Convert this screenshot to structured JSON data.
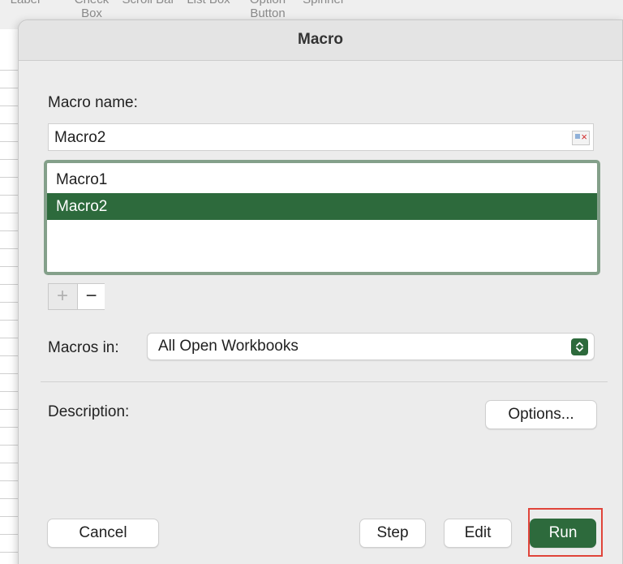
{
  "ribbon": {
    "items": [
      "Label",
      "Check Box",
      "Scroll Bar",
      "List Box",
      "Option Button",
      "Spinner"
    ]
  },
  "dialog": {
    "title": "Macro",
    "macro_name_label": "Macro name:",
    "macro_name_value": "Macro2",
    "macros": [
      "Macro1",
      "Macro2"
    ],
    "selected_macro": "Macro2",
    "add_label": "+",
    "remove_label": "−",
    "macros_in_label": "Macros in:",
    "macros_in_value": "All Open Workbooks",
    "description_label": "Description:",
    "options_button": "Options...",
    "cancel_button": "Cancel",
    "step_button": "Step",
    "edit_button": "Edit",
    "run_button": "Run"
  },
  "colors": {
    "accent": "#2d6a3c",
    "list_border": "#84a08a",
    "highlight": "#e0443a"
  },
  "icons": {
    "name_field_icon": "cell-reference-icon",
    "select_arrow": "up-down-chevron-icon"
  }
}
